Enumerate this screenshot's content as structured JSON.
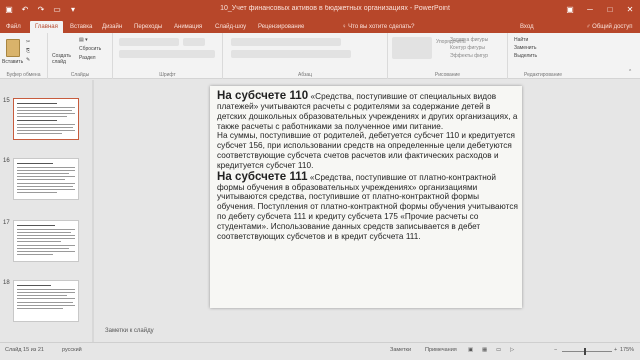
{
  "titlebar": {
    "doc_title": "10_Учет финансовых активов в бюджетных организациях - PowerPoint",
    "minimize": "─",
    "maximize": "□",
    "close": "✕"
  },
  "tabs": [
    "Файл",
    "Главная",
    "Вставка",
    "Дизайн",
    "Переходы",
    "Анимация",
    "Слайд-шоу",
    "Рецензирование"
  ],
  "active_tab": "Главная",
  "tell_me": "♀ Что вы хотите сделать?",
  "sign_in": "Вход",
  "share": "♂ Общий доступ",
  "ribbon": {
    "paste": "Вставить",
    "create_slide": "Создать слайд",
    "reset": "Сбросить",
    "section": "Раздел",
    "group_clipboard": "Буфер обмена",
    "group_slides": "Слайды",
    "group_font": "Шрифт",
    "group_paragraph": "Абзац",
    "group_drawing": "Рисование",
    "group_editing": "Редактирование",
    "find": "Найти",
    "replace": "Заменить",
    "select": "Выделить",
    "shape_fill": "Заливка фигуры",
    "shape_outline": "Контур фигуры",
    "shape_effects": "Эффекты фигур",
    "arrange": "Упорядочить",
    "quick_styles": "Экспресс-стили"
  },
  "slide_numbers": [
    "15",
    "16",
    "17",
    "18"
  ],
  "slide": {
    "heading1": "На субсчете 110",
    "body1": " «Средства, поступившие от специальных видов платежей» учитываются расчеты с родителями за содержание детей в детских дошкольных образовательных учреждениях и других организациях, а также расчеты с работниками за полученное ими питание.",
    "body1b": "На суммы, поступившие от родителей, дебетуется субсчет 110 и кредитуется субсчет 156, при использовании средств на определенные цели дебетуются соответствующие субсчета счетов расчетов или фактических расходов и кредитуется субсчет 110.",
    "heading2": "На субсчете 111",
    "body2": " «Средства, поступившие от платно-контрактной формы обучения в образовательных учреждениях» организациями учитываются средства, поступившие от платно-контрактной формы обучения. Поступления от платно-контрактной формы обучения учитываются по дебету субсчета 111 и кредиту субсчета 175 «Прочие расчеты со студентами». Использование данных средств записывается в дебет соответствующих субсчетов и в кредит субсчета 111."
  },
  "notes_placeholder": "Заметки к слайду",
  "status": {
    "slide_info": "Слайд 15 из 21",
    "language": "русский",
    "notes": "Заметки",
    "comments": "Примечания",
    "zoom": "175%"
  }
}
